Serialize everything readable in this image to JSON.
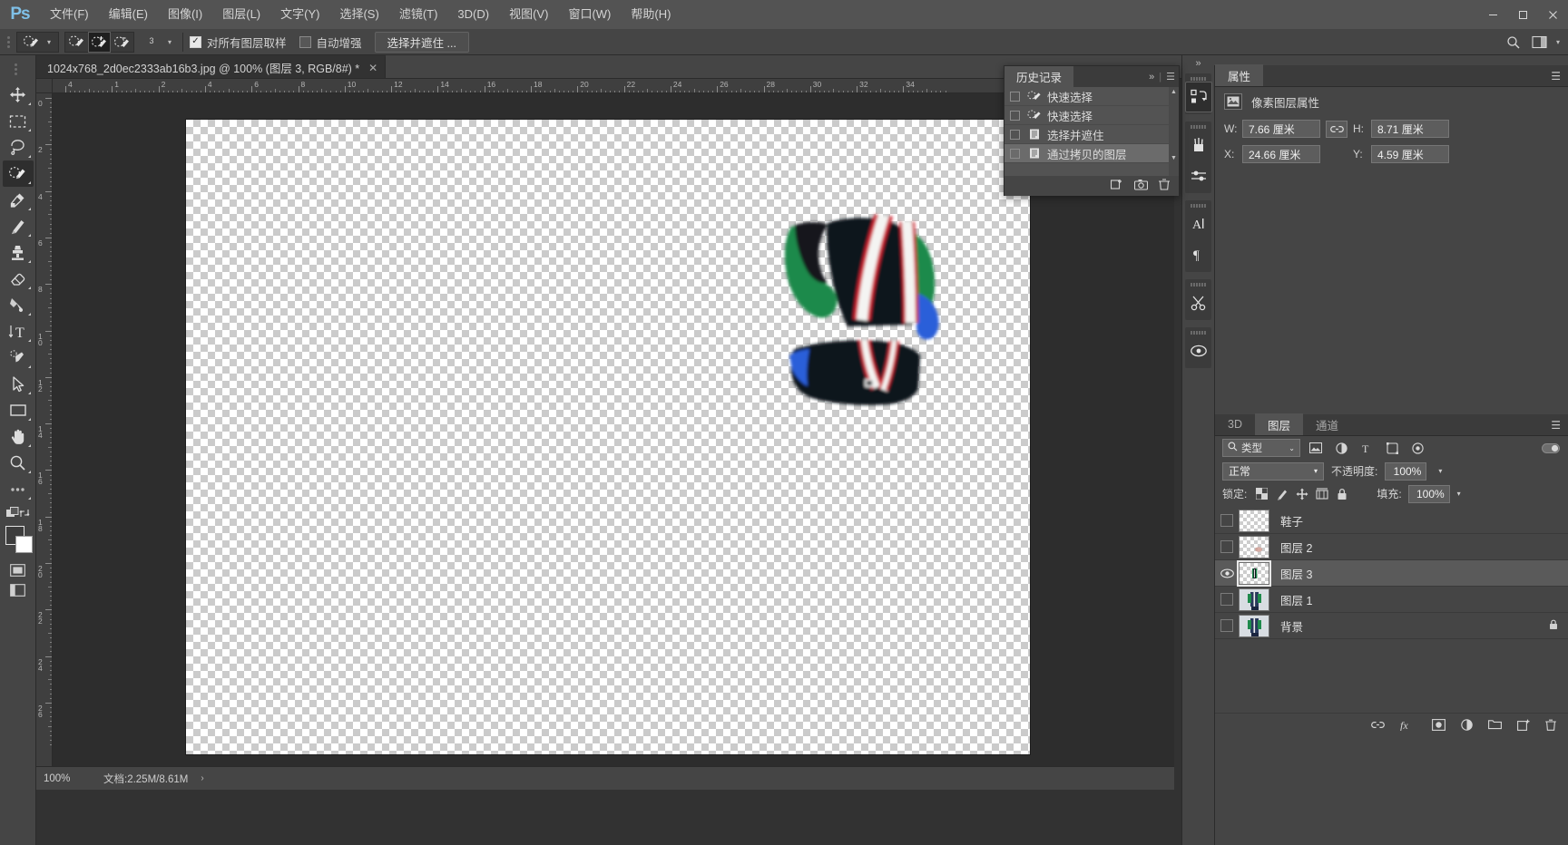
{
  "app": {
    "logo": "Ps",
    "menus": [
      {
        "label": "文件(F)"
      },
      {
        "label": "编辑(E)"
      },
      {
        "label": "图像(I)"
      },
      {
        "label": "图层(L)"
      },
      {
        "label": "文字(Y)"
      },
      {
        "label": "选择(S)"
      },
      {
        "label": "滤镜(T)"
      },
      {
        "label": "3D(D)"
      },
      {
        "label": "视图(V)"
      },
      {
        "label": "窗口(W)"
      },
      {
        "label": "帮助(H)"
      }
    ],
    "window_controls": [
      {
        "name": "minimize",
        "glyph": "—"
      },
      {
        "name": "maximize",
        "glyph": "❐"
      },
      {
        "name": "close",
        "glyph": "✕"
      }
    ]
  },
  "options_bar": {
    "tool_preset_icon": "quick-selection-brush",
    "modes": [
      {
        "name": "new-selection",
        "icon": "quick-selection"
      },
      {
        "name": "add-to-selection",
        "icon": "quick-selection-plus"
      },
      {
        "name": "subtract-from-selection",
        "icon": "quick-selection-minus"
      }
    ],
    "brush_size": "3",
    "sample_all_layers": {
      "label": "对所有图层取样",
      "checked": true
    },
    "auto_enhance": {
      "label": "自动增强",
      "checked": false
    },
    "select_and_mask_button": "选择并遮住 ..."
  },
  "toolbar": {
    "tools": [
      {
        "name": "move-tool",
        "selected": false
      },
      {
        "name": "marquee-tool",
        "selected": false
      },
      {
        "name": "lasso-tool",
        "selected": false
      },
      {
        "name": "quick-selection-tool",
        "selected": true
      },
      {
        "name": "eyedropper-tool",
        "selected": false
      },
      {
        "name": "brush-tool",
        "selected": false
      },
      {
        "name": "clone-stamp-tool",
        "selected": false
      },
      {
        "name": "eraser-tool",
        "selected": false
      },
      {
        "name": "gradient-tool",
        "selected": false
      },
      {
        "name": "type-tool",
        "selected": false
      },
      {
        "name": "pen-tool",
        "selected": false
      },
      {
        "name": "path-selection-tool",
        "selected": false
      },
      {
        "name": "rectangle-tool",
        "selected": false
      },
      {
        "name": "hand-tool",
        "selected": false
      },
      {
        "name": "zoom-tool",
        "selected": false
      },
      {
        "name": "edit-toolbar",
        "selected": false
      }
    ],
    "foreground_color": "#3d3d3d",
    "background_color": "#ffffff"
  },
  "document": {
    "tab_title": "1024x768_2d0ec2333ab16b3.jpg @ 100% (图层 3, RGB/8#) *",
    "close_glyph": "✕",
    "ruler_units_h": [
      "4",
      "1",
      "2",
      "4",
      "6",
      "8",
      "10",
      "12",
      "14",
      "16",
      "18",
      "20",
      "22",
      "24",
      "26",
      "28",
      "30",
      "32",
      "34"
    ],
    "ruler_units_v": [
      "0",
      "2",
      "4",
      "6",
      "8",
      "10",
      "12",
      "14",
      "16",
      "18",
      "20",
      "22",
      "24",
      "26"
    ]
  },
  "status_bar": {
    "zoom": "100%",
    "doc_info": "文档:2.25M/8.61M",
    "expand_glyph": "›"
  },
  "history_panel": {
    "tab_label": "历史记录",
    "collapse_glyph": "»",
    "menu_glyph": "☰",
    "items": [
      {
        "label": "快速选择",
        "icon": "quick-selection-icon",
        "selected": false
      },
      {
        "label": "快速选择",
        "icon": "quick-selection-icon",
        "selected": false
      },
      {
        "label": "选择并遮住",
        "icon": "document-icon",
        "selected": false
      },
      {
        "label": "通过拷贝的图层",
        "icon": "document-icon",
        "selected": true
      }
    ],
    "footer_icons": [
      {
        "name": "new-document-from-state-icon"
      },
      {
        "name": "new-snapshot-icon"
      },
      {
        "name": "delete-state-icon"
      }
    ]
  },
  "properties_panel": {
    "tab_label": "属性",
    "menu_glyph": "☰",
    "title": "像素图层属性",
    "thumb_icon": "pixel-layer-icon",
    "fields": [
      {
        "name": "width",
        "label": "W:",
        "value": "7.66 厘米"
      },
      {
        "name": "height",
        "label": "H:",
        "value": "8.71 厘米"
      },
      {
        "name": "x",
        "label": "X:",
        "value": "24.66 厘米"
      },
      {
        "name": "y",
        "label": "Y:",
        "value": "4.59 厘米"
      }
    ],
    "link_glyph": "⛓"
  },
  "layers_panel": {
    "tabs": [
      {
        "label": "3D",
        "active": false
      },
      {
        "label": "图层",
        "active": true
      },
      {
        "label": "通道",
        "active": false
      }
    ],
    "menu_glyph": "☰",
    "filter": {
      "kind_label": "类型",
      "search_icon": "search-icon",
      "chevron": "⌄"
    },
    "filter_icons": [
      "pixel-filter-icon",
      "adjustment-filter-icon",
      "type-filter-icon",
      "shape-filter-icon",
      "smart-object-filter-icon"
    ],
    "blend_mode": "正常",
    "opacity_label": "不透明度:",
    "opacity_value": "100%",
    "lock_label": "锁定:",
    "lock_icons": [
      "lock-transparent-pixels-icon",
      "lock-image-pixels-icon",
      "lock-position-icon",
      "lock-artboard-icon",
      "lock-all-icon"
    ],
    "fill_label": "填充:",
    "fill_value": "100%",
    "layers": [
      {
        "name": "鞋子",
        "visible": false,
        "selected": false,
        "locked": false,
        "thumb": "empty"
      },
      {
        "name": "图层 2",
        "visible": false,
        "selected": false,
        "locked": false,
        "thumb": "empty"
      },
      {
        "name": "图层 3",
        "visible": true,
        "selected": true,
        "locked": false,
        "thumb": "cutout"
      },
      {
        "name": "图层 1",
        "visible": false,
        "selected": false,
        "locked": false,
        "thumb": "photo"
      },
      {
        "name": "背景",
        "visible": false,
        "selected": false,
        "locked": true,
        "thumb": "photo",
        "lock_glyph": "🔒"
      }
    ],
    "footer_icons": [
      {
        "name": "link-layers-icon"
      },
      {
        "name": "layer-style-icon"
      },
      {
        "name": "layer-mask-icon"
      },
      {
        "name": "adjustment-layer-icon"
      },
      {
        "name": "new-group-icon"
      },
      {
        "name": "new-layer-icon"
      },
      {
        "name": "delete-layer-icon"
      }
    ]
  },
  "dock_rail": {
    "collapse_glyph": "»",
    "icons": [
      {
        "name": "libraries-icon",
        "active": true
      },
      {
        "name": "brushes-icon",
        "active": false
      },
      {
        "name": "brush-settings-icon",
        "active": false
      },
      {
        "name": "character-icon",
        "active": false
      },
      {
        "name": "paragraph-icon",
        "active": false
      },
      {
        "name": "scissors-icon",
        "active": false
      },
      {
        "name": "mask-icon",
        "active": false
      }
    ]
  },
  "colors": {
    "accent_blue": "#7fc0e8",
    "panel_bg": "#454545",
    "panel_light": "#535353",
    "canvas_bg": "#2d2d2d",
    "menubar_bg": "#535353",
    "selection_row": "#6b6b6b"
  }
}
